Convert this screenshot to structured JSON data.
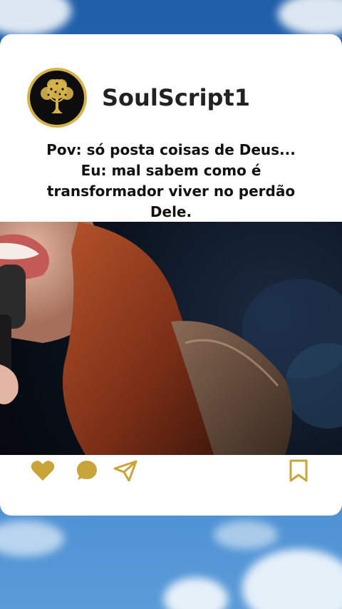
{
  "post": {
    "username": "SoulScript1",
    "caption_lines": [
      "Pov: só posta coisas de Deus...",
      "Eu: mal sabem como é",
      "transformador viver no perdão",
      "Dele."
    ]
  },
  "colors": {
    "accent_gold": "#c9a43a",
    "card_bg": "#ffffff"
  },
  "icons": {
    "like": "heart-icon",
    "comment": "comment-icon",
    "share": "send-icon",
    "save": "bookmark-icon"
  }
}
